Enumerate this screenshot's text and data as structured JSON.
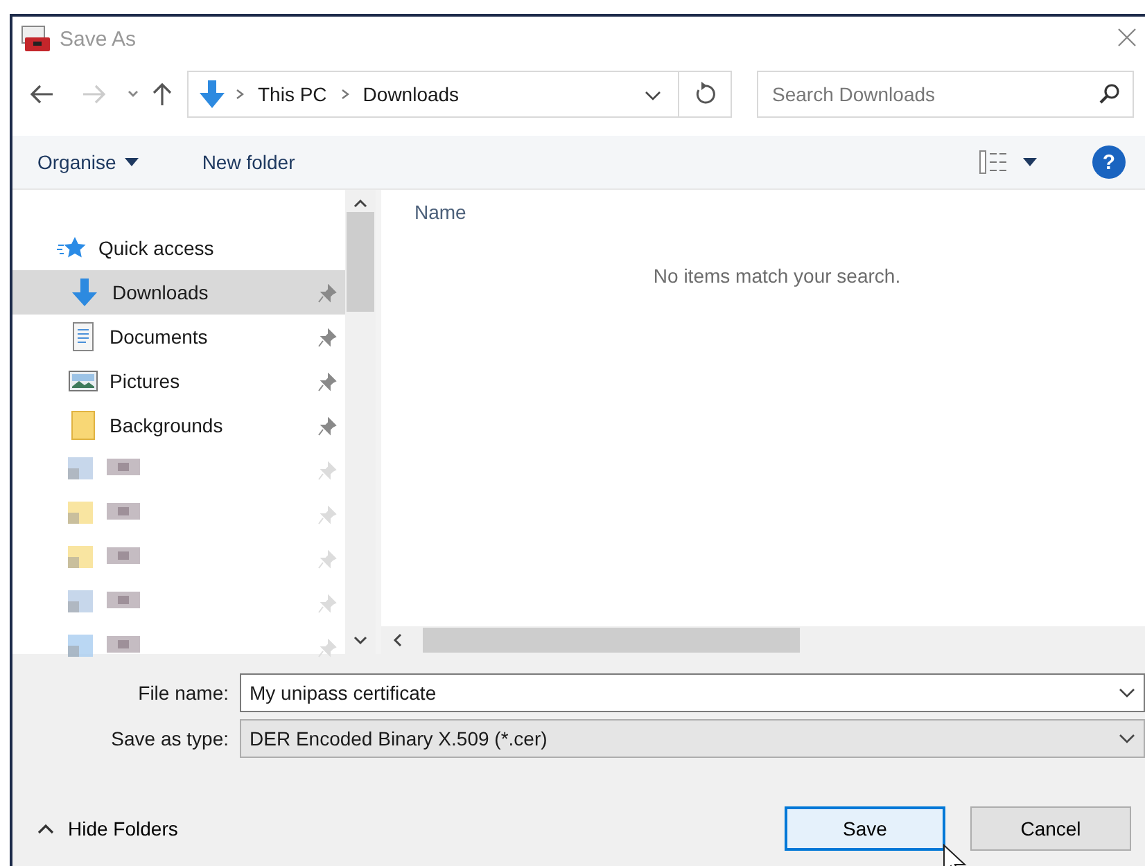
{
  "window": {
    "title": "Save As"
  },
  "navigation": {
    "path": [
      "This PC",
      "Downloads"
    ],
    "search": {
      "placeholder": "Search Downloads"
    }
  },
  "toolbar": {
    "organise": "Organise",
    "new_folder": "New folder",
    "help": "?"
  },
  "sidebar": {
    "items": [
      {
        "kind": "quick",
        "label": "Quick access",
        "selected": false,
        "pinned": false
      },
      {
        "kind": "downloads",
        "label": "Downloads",
        "selected": true,
        "pinned": true
      },
      {
        "kind": "documents",
        "label": "Documents",
        "selected": false,
        "pinned": true
      },
      {
        "kind": "pictures",
        "label": "Pictures",
        "selected": false,
        "pinned": true
      },
      {
        "kind": "folder",
        "label": "Backgrounds",
        "selected": false,
        "pinned": true
      },
      {
        "kind": "blurred-drive",
        "selected": false,
        "pinned": true
      },
      {
        "kind": "blurred-folder",
        "selected": false,
        "pinned": true
      },
      {
        "kind": "blurred-folder",
        "selected": false,
        "pinned": true
      },
      {
        "kind": "blurred-drive",
        "selected": false,
        "pinned": true
      },
      {
        "kind": "blurred-net",
        "selected": false,
        "pinned": true
      }
    ]
  },
  "file_list": {
    "columns": [
      "Name"
    ],
    "empty_message": "No items match your search."
  },
  "form": {
    "file_name": {
      "label": "File name:",
      "value": "My unipass certificate"
    },
    "save_as_type": {
      "label": "Save as type:",
      "value": "DER Encoded Binary X.509 (*.cer)"
    }
  },
  "footer": {
    "hide_folders": "Hide Folders",
    "buttons": [
      {
        "label": "Save",
        "default": true
      },
      {
        "label": "Cancel",
        "default": false
      }
    ]
  }
}
